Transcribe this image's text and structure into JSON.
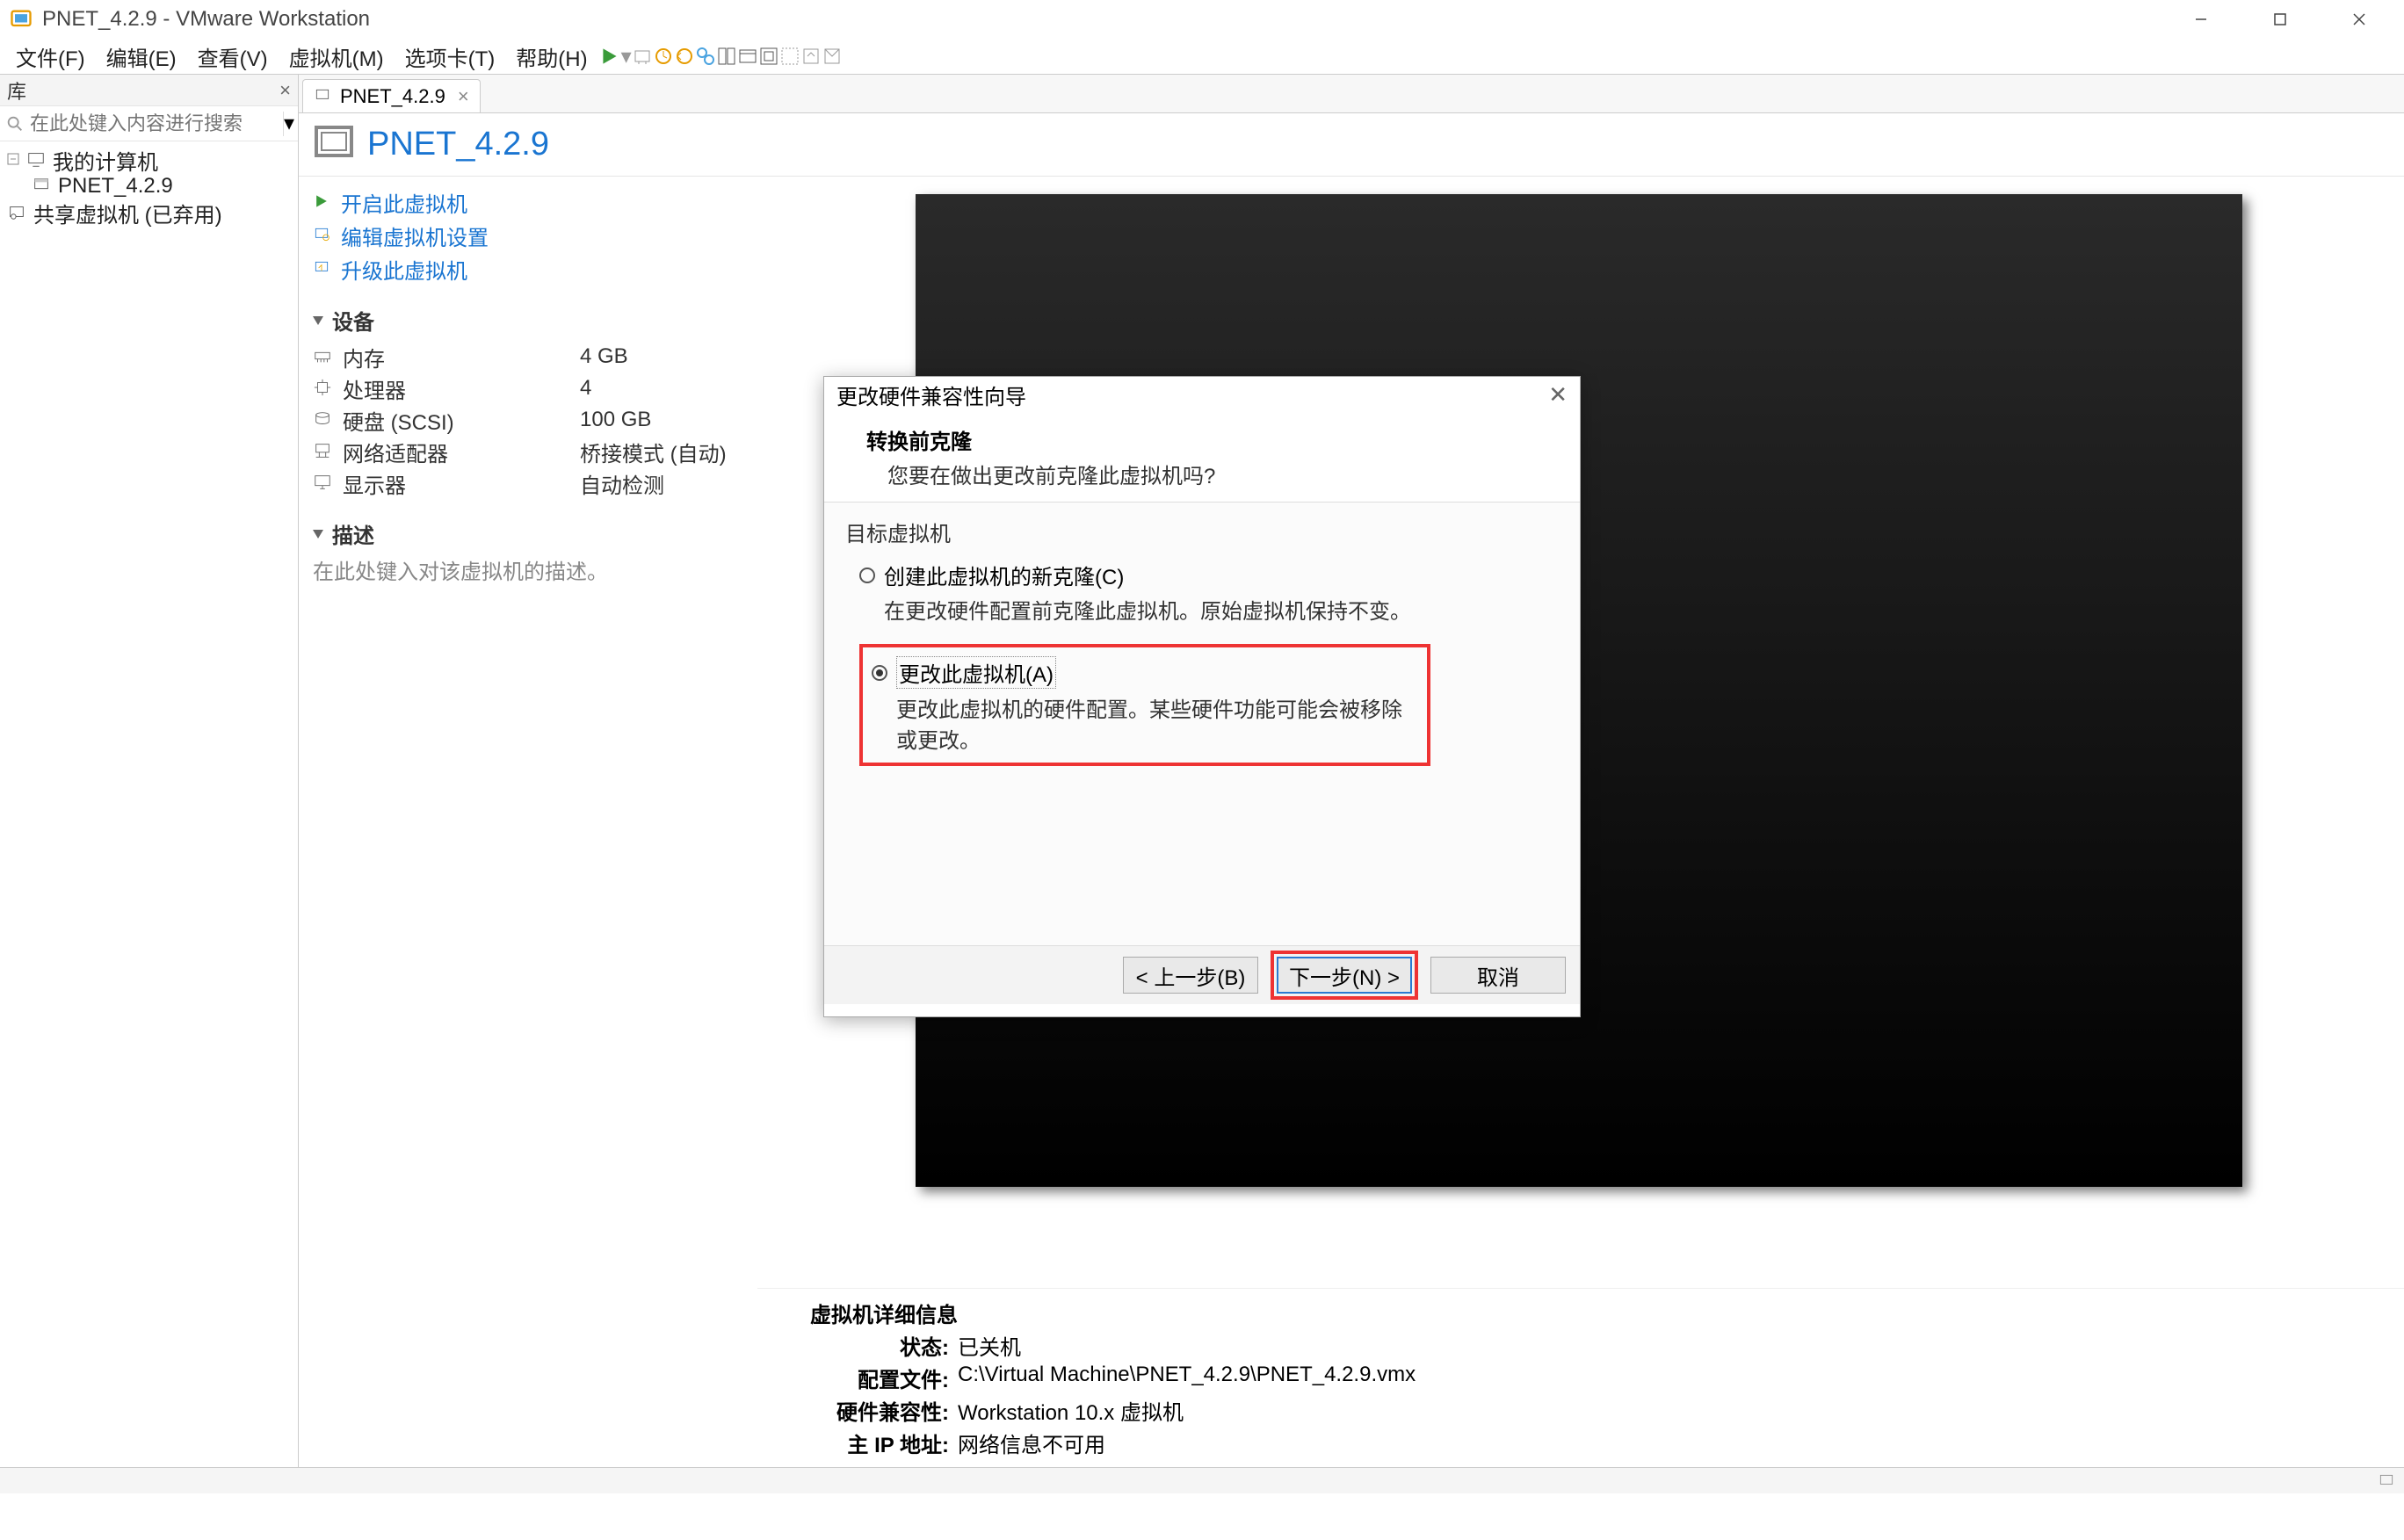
{
  "window": {
    "title": "PNET_4.2.9 - VMware Workstation"
  },
  "menus": {
    "file": "文件(F)",
    "edit": "编辑(E)",
    "view": "查看(V)",
    "vm": "虚拟机(M)",
    "tabs": "选项卡(T)",
    "help": "帮助(H)"
  },
  "library": {
    "title": "库",
    "search_placeholder": "在此处键入内容进行搜索",
    "my_computer": "我的计算机",
    "vm_item": "PNET_4.2.9",
    "shared": "共享虚拟机 (已弃用)"
  },
  "tab": {
    "label": "PNET_4.2.9"
  },
  "vm": {
    "title": "PNET_4.2.9",
    "actions": {
      "power_on": "开启此虚拟机",
      "edit_settings": "编辑虚拟机设置",
      "upgrade": "升级此虚拟机"
    },
    "devices_header": "设备",
    "devices": {
      "memory_label": "内存",
      "memory_value": "4 GB",
      "cpu_label": "处理器",
      "cpu_value": "4",
      "disk_label": "硬盘 (SCSI)",
      "disk_value": "100 GB",
      "net_label": "网络适配器",
      "net_value": "桥接模式 (自动)",
      "display_label": "显示器",
      "display_value": "自动检测"
    },
    "desc_header": "描述",
    "desc_placeholder": "在此处键入对该虚拟机的描述。"
  },
  "dialog": {
    "title": "更改硬件兼容性向导",
    "subtitle": "转换前克隆",
    "subtitle_desc": "您要在做出更改前克隆此虚拟机吗?",
    "group": "目标虚拟机",
    "opt1_label": "创建此虚拟机的新克隆(C)",
    "opt1_desc": "在更改硬件配置前克隆此虚拟机。原始虚拟机保持不变。",
    "opt2_label": "更改此虚拟机(A)",
    "opt2_desc": "更改此虚拟机的硬件配置。某些硬件功能可能会被移除或更改。",
    "back": "< 上一步(B)",
    "next": "下一步(N) >",
    "cancel": "取消"
  },
  "details": {
    "header": "虚拟机详细信息",
    "status_k": "状态:",
    "status_v": "已关机",
    "config_k": "配置文件:",
    "config_v": "C:\\Virtual Machine\\PNET_4.2.9\\PNET_4.2.9.vmx",
    "hw_k": "硬件兼容性:",
    "hw_v": "Workstation 10.x 虚拟机",
    "ip_k": "主 IP 地址:",
    "ip_v": "网络信息不可用"
  }
}
